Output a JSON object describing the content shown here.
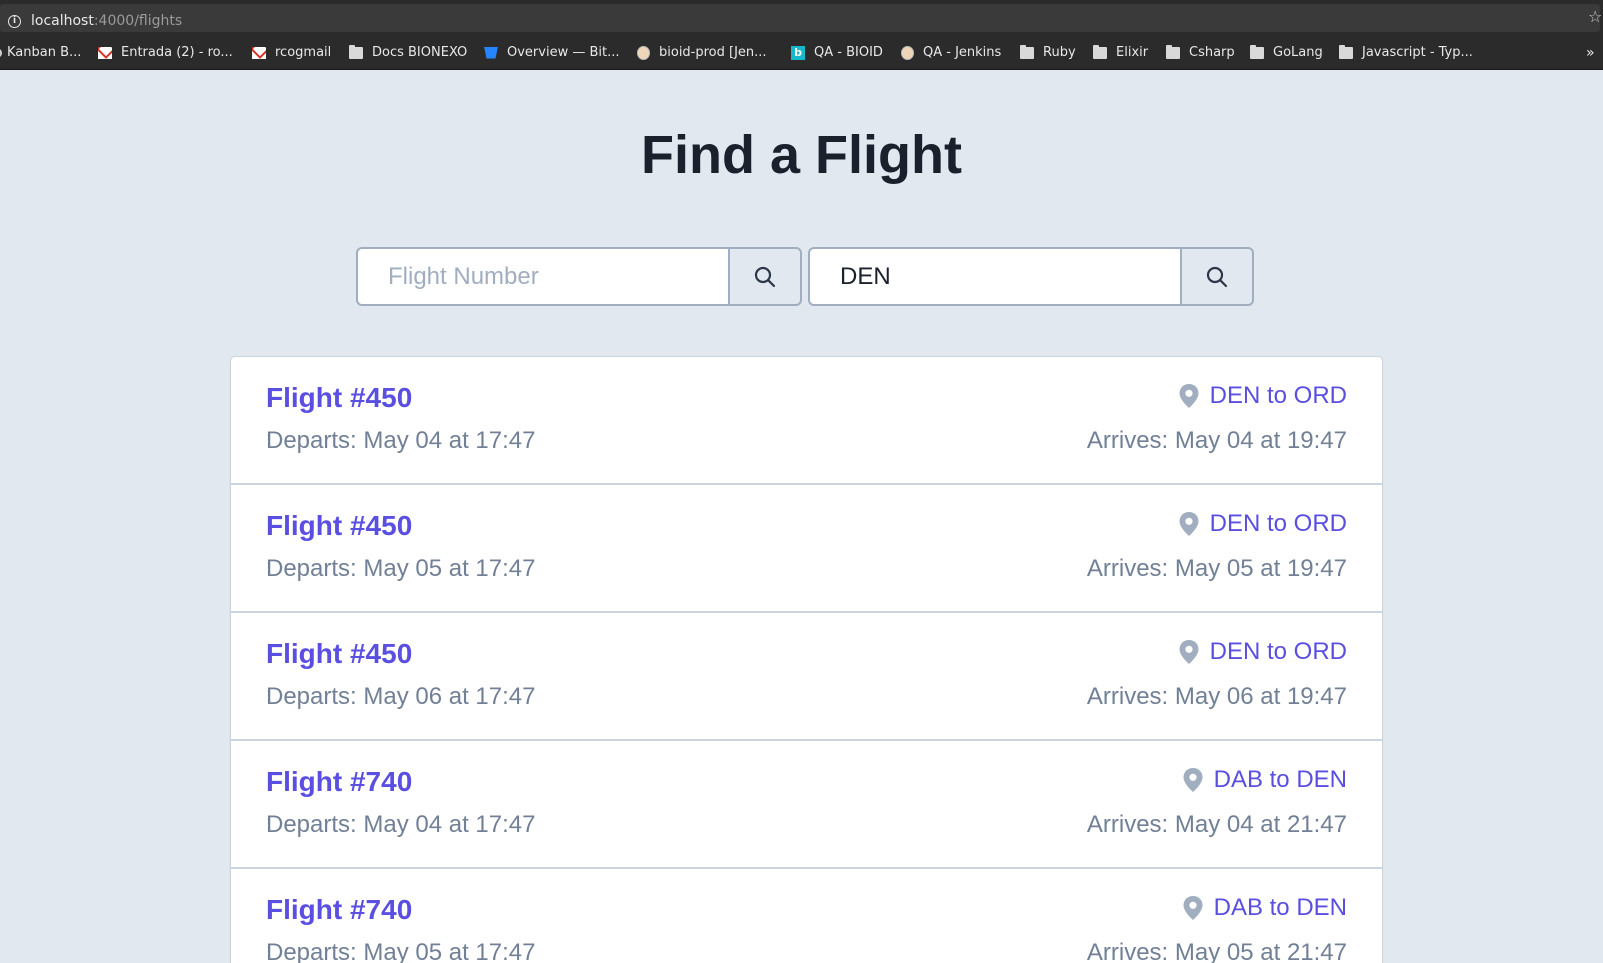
{
  "browser": {
    "url_host": "localhost",
    "url_path": ":4000/flights",
    "bookmarks": [
      {
        "label": "Kanban B...",
        "icon": "kanban-icon"
      },
      {
        "label": "Entrada (2) - ro...",
        "icon": "gmail-icon"
      },
      {
        "label": "rcogmail",
        "icon": "gmail-icon"
      },
      {
        "label": "Docs BIONEXO",
        "icon": "folder-icon"
      },
      {
        "label": "Overview — Bit...",
        "icon": "bitbucket-icon"
      },
      {
        "label": "bioid-prod [Jen...",
        "icon": "jenkins-icon"
      },
      {
        "label": "QA - BIOID",
        "icon": "b-icon"
      },
      {
        "label": "QA - Jenkins",
        "icon": "jenkins-icon"
      },
      {
        "label": "Ruby",
        "icon": "folder-icon"
      },
      {
        "label": "Elixir",
        "icon": "folder-icon"
      },
      {
        "label": "Csharp",
        "icon": "folder-icon"
      },
      {
        "label": "GoLang",
        "icon": "folder-icon"
      },
      {
        "label": "Javascript - Typ...",
        "icon": "folder-icon"
      }
    ],
    "more_label": "»"
  },
  "page": {
    "title": "Find a Flight"
  },
  "search": {
    "flight_number": {
      "placeholder": "Flight Number",
      "value": ""
    },
    "airport": {
      "placeholder": "",
      "value": "DEN"
    }
  },
  "flights": [
    {
      "number": "Flight #450",
      "route": "DEN to ORD",
      "departs": "Departs: May 04 at 17:47",
      "arrives": "Arrives: May 04 at 19:47"
    },
    {
      "number": "Flight #450",
      "route": "DEN to ORD",
      "departs": "Departs: May 05 at 17:47",
      "arrives": "Arrives: May 05 at 19:47"
    },
    {
      "number": "Flight #450",
      "route": "DEN to ORD",
      "departs": "Departs: May 06 at 17:47",
      "arrives": "Arrives: May 06 at 19:47"
    },
    {
      "number": "Flight #740",
      "route": "DAB to DEN",
      "departs": "Departs: May 04 at 17:47",
      "arrives": "Arrives: May 04 at 21:47"
    },
    {
      "number": "Flight #740",
      "route": "DAB to DEN",
      "departs": "Departs: May 05 at 17:47",
      "arrives": "Arrives: May 05 at 21:47"
    }
  ],
  "colors": {
    "background": "#e2e8f0",
    "accent": "#5a4fe0",
    "muted_text": "#718096",
    "title": "#1a202c"
  }
}
